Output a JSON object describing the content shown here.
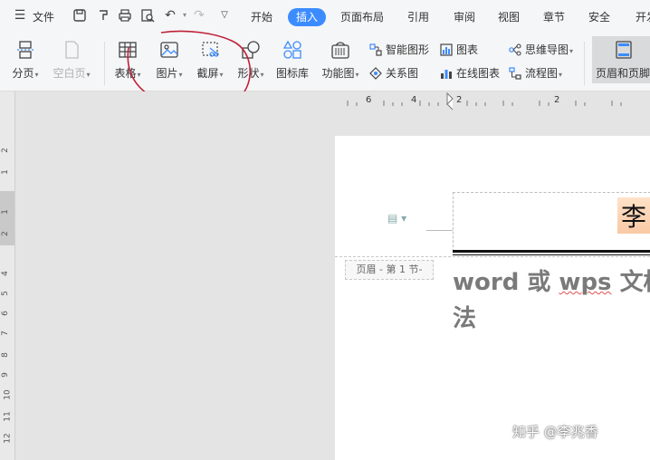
{
  "menubar": {
    "file_label": "文件",
    "tabs": [
      "开始",
      "插入",
      "页面布局",
      "引用",
      "审阅",
      "视图",
      "章节",
      "安全",
      "开发"
    ],
    "active_tab": "插入"
  },
  "ribbon": {
    "page_break": "分页",
    "blank_page": "空白页",
    "table": "表格",
    "picture": "图片",
    "screenshot": "截屏",
    "shape": "形状",
    "icon_library": "图标库",
    "function_chart": "功能图",
    "smart_graphic": "智能图形",
    "chart": "图表",
    "mind_map": "思维导图",
    "relation_chart": "关系图",
    "online_chart": "在线图表",
    "flow_chart": "流程图",
    "header_footer": "页眉和页脚"
  },
  "ruler": {
    "h_marks": [
      "6",
      "4",
      "2",
      "2"
    ],
    "v_marks": [
      "2",
      "1",
      "1",
      "2",
      "4",
      "5",
      "6",
      "7",
      "8",
      "9",
      "10",
      "11",
      "12"
    ]
  },
  "document": {
    "header_tag": "页眉 - 第 1 节-",
    "header_name": "李",
    "title_line1_a": "word 或 ",
    "title_line1_b": "wps",
    "title_line1_c": " 文档",
    "title_line2": "法",
    "watermark": "知乎 @李兆香"
  },
  "colors": {
    "accent": "#3c8cff",
    "annotation": "#c0203a"
  }
}
